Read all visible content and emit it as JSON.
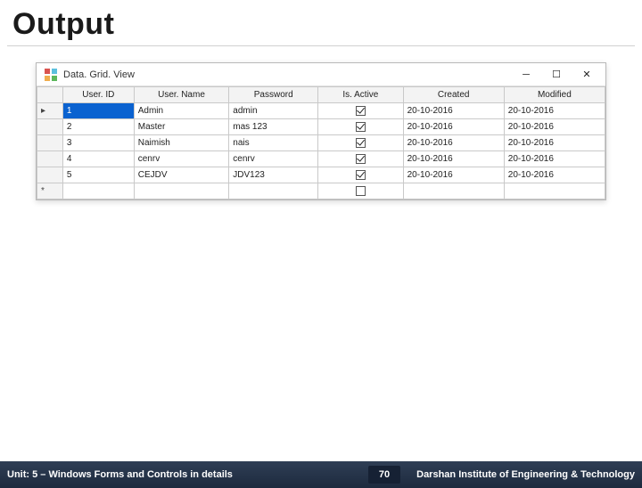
{
  "slide": {
    "title": "Output"
  },
  "window": {
    "title": "Data. Grid. View"
  },
  "grid": {
    "headers": {
      "id": "User. ID",
      "name": "User. Name",
      "password": "Password",
      "active": "Is. Active",
      "created": "Created",
      "modified": "Modified"
    },
    "rows": [
      {
        "marker": "▸",
        "id": "1",
        "name": "Admin",
        "password": "admin",
        "active": true,
        "created": "20-10-2016",
        "modified": "20-10-2016",
        "selected": true
      },
      {
        "marker": "",
        "id": "2",
        "name": "Master",
        "password": "mas 123",
        "active": true,
        "created": "20-10-2016",
        "modified": "20-10-2016",
        "selected": false
      },
      {
        "marker": "",
        "id": "3",
        "name": "Naimish",
        "password": "nais",
        "active": true,
        "created": "20-10-2016",
        "modified": "20-10-2016",
        "selected": false
      },
      {
        "marker": "",
        "id": "4",
        "name": "cenrv",
        "password": "cenrv",
        "active": true,
        "created": "20-10-2016",
        "modified": "20-10-2016",
        "selected": false
      },
      {
        "marker": "",
        "id": "5",
        "name": "CEJDV",
        "password": "JDV123",
        "active": true,
        "created": "20-10-2016",
        "modified": "20-10-2016",
        "selected": false
      }
    ],
    "new_row_marker": "*"
  },
  "footer": {
    "unit": "Unit: 5 – Windows Forms and Controls in details",
    "page": "70",
    "institute": "Darshan Institute of Engineering & Technology"
  }
}
